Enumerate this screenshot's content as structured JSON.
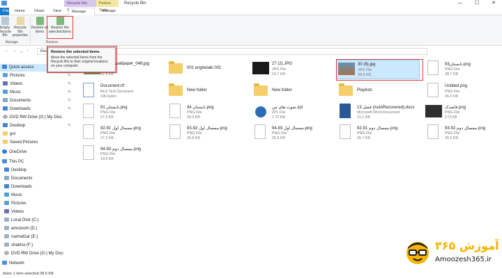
{
  "window": {
    "title": "Recycle Bin",
    "context_groups": [
      "Recycle Bin Tools",
      "Picture Tools"
    ],
    "controls": [
      "—",
      "☐",
      "✕"
    ]
  },
  "tabs": [
    "File",
    "Home",
    "Share",
    "View",
    "Manage",
    "Manage"
  ],
  "ribbon": {
    "buttons": [
      {
        "label": "Empty Recycle Bin"
      },
      {
        "label": "Recycle Bin properties"
      },
      {
        "label": "Restore all items"
      },
      {
        "label": "Restore the selected items"
      }
    ],
    "groups": [
      "Manage",
      "Restore"
    ]
  },
  "tooltip": {
    "title": "Restore the selected items",
    "description": "Move the selected items from the Recycle Bin to their original locations on your computer."
  },
  "address": {
    "path": "Recycle Bin"
  },
  "nav": {
    "items": [
      {
        "label": "Quick access"
      },
      {
        "label": "Pictures"
      },
      {
        "label": "Videos"
      },
      {
        "label": "Music"
      },
      {
        "label": "Documents"
      },
      {
        "label": "Downloads"
      },
      {
        "label": "DVD RW Drive (G:) My Disc"
      },
      {
        "label": "Desktop"
      },
      {
        "label": "gol"
      },
      {
        "label": "Saved Pictures"
      },
      {
        "label": "OneDrive"
      },
      {
        "label": "This PC"
      },
      {
        "label": "Desktop"
      },
      {
        "label": "Documents"
      },
      {
        "label": "Downloads"
      },
      {
        "label": "Music"
      },
      {
        "label": "Pictures"
      },
      {
        "label": "Videos"
      },
      {
        "label": "Local Disk (C:)"
      },
      {
        "label": "amozeshi (D:)"
      },
      {
        "label": "narmafzar (E:)"
      },
      {
        "label": "shakhsi (F:)"
      },
      {
        "label": "DVD RW Drive (G:) My Disc"
      },
      {
        "label": "Network"
      }
    ]
  },
  "files": [
    {
      "name": "Nature_wallpaper_048.jpg",
      "type": "",
      "size": "91.8 KB"
    },
    {
      "name": "001 enghelabi 001",
      "type": "",
      "size": ""
    },
    {
      "name": "27 (2).JPG",
      "type": "JPG File",
      "size": "23.7 KB"
    },
    {
      "name": "30 (6).jpg",
      "type": "JPG File",
      "size": "38.5 KB"
    },
    {
      "name": "تابستان93.png",
      "type": "PNG File",
      "size": "38.7 KB"
    },
    {
      "name": "Document.rtf",
      "type": "Rich Text Document",
      "size": "196 bytes"
    },
    {
      "name": "New folder",
      "type": "",
      "size": ""
    },
    {
      "name": "New folder",
      "type": "",
      "size": ""
    },
    {
      "name": "Playlists",
      "type": "",
      "size": ""
    },
    {
      "name": "Untitled.png",
      "type": "PNG File",
      "size": "45.0 KB"
    },
    {
      "name": "91 تابستان.png",
      "type": "PNG File",
      "size": "27.3 KB"
    },
    {
      "name": "94 تابستان.png",
      "type": "PNG File",
      "size": "26.9 KB"
    },
    {
      "name": "صوت های من.zpl",
      "type": "ZPL File",
      "size": "1.70 KB"
    },
    {
      "name": "فصل 13 (AutoRecovered).docx",
      "type": "Microsoft Word Document",
      "size": "21.1 KB"
    },
    {
      "name": "قاصدک.png",
      "type": "PNG File",
      "size": "173 KB"
    },
    {
      "name": "92-91 نیمسال اول.png",
      "type": "PNG File",
      "size": "27.3 KB"
    },
    {
      "name": "93-92 نیمسال اول.png",
      "type": "PNG File",
      "size": "26.8 KB"
    },
    {
      "name": "94-93 نیمسال اول.png",
      "type": "PNG File",
      "size": "25.9 KB"
    },
    {
      "name": "92-91 نیمسال دوم.png",
      "type": "PNG File",
      "size": "26.7 KB"
    },
    {
      "name": "93-92 نیمسال دوم.png",
      "type": "PNG File",
      "size": "26.2 KB"
    },
    {
      "name": "94-93 نیمسال دوم.png",
      "type": "PNG File",
      "size": "19.6 KB"
    }
  ],
  "status": {
    "text": "items     1 item selected  38.5 KB"
  },
  "logo": {
    "brand": "آموزش ۳۶۵",
    "site": "Amoozesh365.ir"
  },
  "colors": {
    "accent": "#1979ca",
    "selection": "#cce8ff",
    "highlight": "#e23b3b",
    "brand": "#f6b400"
  }
}
